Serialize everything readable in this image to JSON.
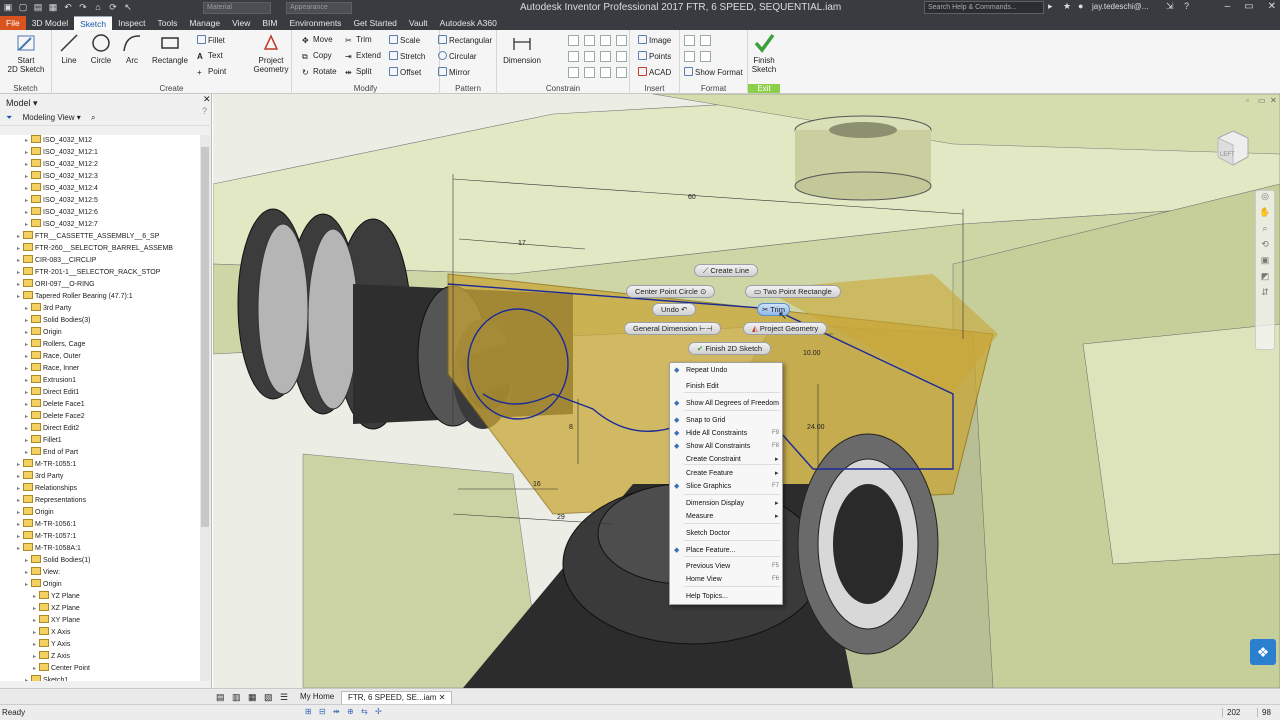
{
  "window": {
    "title": "Autodesk Inventor Professional 2017    FTR, 6 SPEED, SEQUENTIAL.iam",
    "combo1": "Material",
    "combo2": "Appearance",
    "help_search_placeholder": "Search Help & Commands...",
    "user": "jay.tedeschi@..."
  },
  "menu_tabs": [
    "File",
    "3D Model",
    "Sketch",
    "Inspect",
    "Tools",
    "Manage",
    "View",
    "BIM",
    "Environments",
    "Get Started",
    "Vault",
    "Autodesk A360"
  ],
  "active_tab": "Sketch",
  "ribbon": {
    "sketch": {
      "title": "Sketch",
      "start": "Start",
      "start2": "2D Sketch"
    },
    "create": {
      "title": "Create",
      "line": "Line",
      "circle": "Circle",
      "arc": "Arc",
      "rectangle": "Rectangle",
      "fillet": "Fillet",
      "text": "Text",
      "point": "Point",
      "project1": "Project",
      "project2": "Geometry"
    },
    "modify": {
      "title": "Modify",
      "move": "Move",
      "copy": "Copy",
      "rotate": "Rotate",
      "trim": "Trim",
      "extend": "Extend",
      "split": "Split",
      "scale": "Scale",
      "stretch": "Stretch",
      "offset": "Offset"
    },
    "pattern": {
      "title": "Pattern",
      "rectangular": "Rectangular",
      "circular": "Circular",
      "mirror": "Mirror"
    },
    "constrain": {
      "title": "Constrain",
      "dimension": "Dimension"
    },
    "insert": {
      "title": "Insert",
      "image": "Image",
      "points": "Points",
      "acad": "ACAD"
    },
    "format": {
      "title": "Format",
      "show_format": "Show Format"
    },
    "exit": {
      "title": "Exit",
      "finish1": "Finish",
      "finish2": "Sketch"
    }
  },
  "browser": {
    "title": "Model",
    "view_mode": "Modeling View",
    "items": [
      {
        "label": "ISO_4032_M12",
        "indent": 2
      },
      {
        "label": "ISO_4032_M12:1",
        "indent": 2
      },
      {
        "label": "ISO_4032_M12:2",
        "indent": 2
      },
      {
        "label": "ISO_4032_M12:3",
        "indent": 2
      },
      {
        "label": "ISO_4032_M12:4",
        "indent": 2
      },
      {
        "label": "ISO_4032_M12:5",
        "indent": 2
      },
      {
        "label": "ISO_4032_M12:6",
        "indent": 2
      },
      {
        "label": "ISO_4032_M12:7",
        "indent": 2
      },
      {
        "label": "FTR__CASSETTE_ASSEMBLY__6_SP",
        "indent": 1
      },
      {
        "label": "FTR-260__SELECTOR_BARREL_ASSEMB",
        "indent": 1
      },
      {
        "label": "CIR-083__CIRCLIP",
        "indent": 1
      },
      {
        "label": "FTR-201-1__SELECTOR_RACK_STOP",
        "indent": 1
      },
      {
        "label": "ORI-097__O-RING",
        "indent": 1
      },
      {
        "label": "Tapered Roller Bearing (47.7):1",
        "indent": 1
      },
      {
        "label": "3rd Party",
        "indent": 2
      },
      {
        "label": "Solid Bodies(3)",
        "indent": 2
      },
      {
        "label": "Origin",
        "indent": 2
      },
      {
        "label": "Rollers, Cage",
        "indent": 2
      },
      {
        "label": "Race, Outer",
        "indent": 2
      },
      {
        "label": "Race, Inner",
        "indent": 2
      },
      {
        "label": "Extrusion1",
        "indent": 2
      },
      {
        "label": "Direct Edit1",
        "indent": 2
      },
      {
        "label": "Delete Face1",
        "indent": 2
      },
      {
        "label": "Delete Face2",
        "indent": 2
      },
      {
        "label": "Direct Edit2",
        "indent": 2
      },
      {
        "label": "Fillet1",
        "indent": 2
      },
      {
        "label": "End of Part",
        "indent": 2
      },
      {
        "label": "M-TR-1055:1",
        "indent": 1
      },
      {
        "label": "3rd Party",
        "indent": 1
      },
      {
        "label": "Relationships",
        "indent": 1
      },
      {
        "label": "Representations",
        "indent": 1
      },
      {
        "label": "Origin",
        "indent": 1
      },
      {
        "label": "M-TR-1056:1",
        "indent": 1
      },
      {
        "label": "M-TR-1057:1",
        "indent": 1
      },
      {
        "label": "M-TR-1058A:1",
        "indent": 1
      },
      {
        "label": "Solid Bodies(1)",
        "indent": 2
      },
      {
        "label": "View:",
        "indent": 2
      },
      {
        "label": "Origin",
        "indent": 2
      },
      {
        "label": "YZ Plane",
        "indent": 3
      },
      {
        "label": "XZ Plane",
        "indent": 3
      },
      {
        "label": "XY Plane",
        "indent": 3
      },
      {
        "label": "X Axis",
        "indent": 3
      },
      {
        "label": "Y Axis",
        "indent": 3
      },
      {
        "label": "Z Axis",
        "indent": 3
      },
      {
        "label": "Center Point",
        "indent": 3
      },
      {
        "label": "Sketch1",
        "indent": 2
      }
    ]
  },
  "marking_menu": {
    "create_line": "Create Line",
    "center_point_circle": "Center Point Circle",
    "two_point_rectangle": "Two Point Rectangle",
    "undo": "Undo",
    "trim": "Trim",
    "general_dimension": "General Dimension",
    "project_geometry": "Project Geometry",
    "finish_2d_sketch": "Finish 2D Sketch"
  },
  "context_menu": [
    {
      "label": "Repeat Undo",
      "icon": "undo-icon",
      "sub": false,
      "accel": ""
    },
    {
      "label": "Finish Edit",
      "icon": "",
      "sub": false,
      "accel": ""
    },
    {
      "label": "Show All Degrees of Freedom",
      "icon": "dof-icon",
      "sub": false,
      "accel": ""
    },
    {
      "label": "Snap to Grid",
      "icon": "grid-icon",
      "sub": false,
      "accel": ""
    },
    {
      "label": "Hide All Constraints",
      "icon": "constraint-icon",
      "sub": false,
      "accel": "F9"
    },
    {
      "label": "Show All Constraints",
      "icon": "constraint-icon",
      "sub": false,
      "accel": "F8"
    },
    {
      "label": "Create Constraint",
      "icon": "",
      "sub": true,
      "accel": ""
    },
    {
      "label": "Create Feature",
      "icon": "",
      "sub": true,
      "accel": ""
    },
    {
      "label": "Slice Graphics",
      "icon": "slice-icon",
      "sub": false,
      "accel": "F7"
    },
    {
      "label": "Dimension Display",
      "icon": "",
      "sub": true,
      "accel": ""
    },
    {
      "label": "Measure",
      "icon": "",
      "sub": true,
      "accel": ""
    },
    {
      "label": "Sketch Doctor",
      "icon": "",
      "sub": false,
      "accel": ""
    },
    {
      "label": "Place Feature...",
      "icon": "feature-icon",
      "sub": false,
      "accel": ""
    },
    {
      "label": "Previous View",
      "icon": "",
      "sub": false,
      "accel": "F5"
    },
    {
      "label": "Home View",
      "icon": "",
      "sub": false,
      "accel": "F6"
    },
    {
      "label": "Help Topics...",
      "icon": "",
      "sub": false,
      "accel": ""
    }
  ],
  "dimensions": {
    "d60": "60",
    "d17": "17",
    "d10": "10.00",
    "d24": "24.00",
    "d8": "8",
    "d16": "16",
    "d29": "29"
  },
  "viewcube_label": "LEFT",
  "bottom_tabs": {
    "home": "My Home",
    "doc": "FTR, 6 SPEED, SE...iam"
  },
  "status": {
    "text": "Ready",
    "num1": "202",
    "num2": "98"
  }
}
